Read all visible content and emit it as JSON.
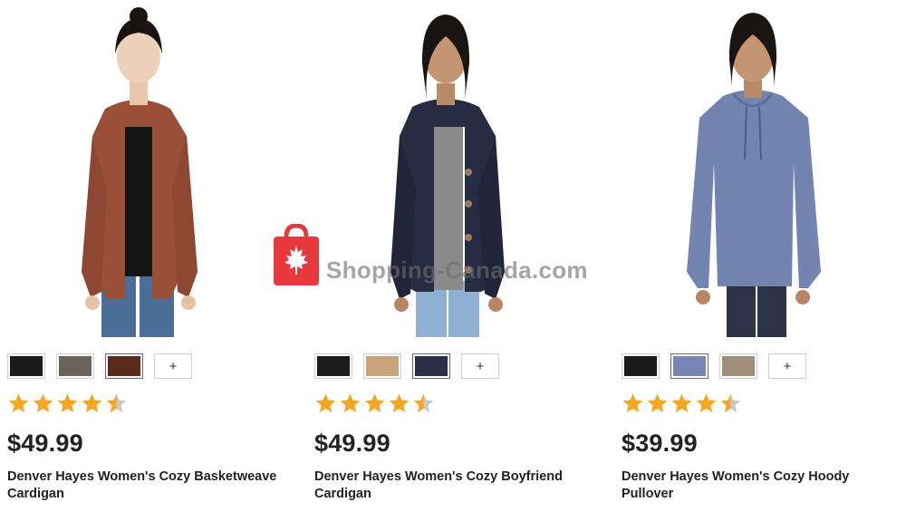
{
  "products": [
    {
      "price": "$49.99",
      "name": "Denver Hayes Women's Cozy Basketweave Cardigan",
      "rating": 4.5,
      "swatches": [
        {
          "color": "#1b1b1b",
          "label": "black"
        },
        {
          "color": "#6b6259",
          "label": "taupe"
        },
        {
          "color": "#5a2a1c",
          "label": "rust"
        }
      ],
      "more_swatches_label": "+",
      "garment_color": "#9a4f38",
      "image_alt": "Woman wearing brown open cardigan"
    },
    {
      "price": "$49.99",
      "name": "Denver Hayes Women's Cozy Boyfriend Cardigan",
      "rating": 4.5,
      "swatches": [
        {
          "color": "#1c1c1c",
          "label": "black"
        },
        {
          "color": "#c9a37a",
          "label": "camel"
        },
        {
          "color": "#2a2f48",
          "label": "navy"
        }
      ],
      "more_swatches_label": "+",
      "garment_color": "#262c42",
      "image_alt": "Woman wearing navy boyfriend cardigan"
    },
    {
      "price": "$39.99",
      "name": "Denver Hayes Women's Cozy Hoody Pullover",
      "rating": 4.5,
      "swatches": [
        {
          "color": "#1a1a1a",
          "label": "black"
        },
        {
          "color": "#7586b5",
          "label": "blue"
        },
        {
          "color": "#a08d7c",
          "label": "mocha"
        }
      ],
      "more_swatches_label": "+",
      "garment_color": "#7384b0",
      "image_alt": "Woman wearing blue hoody pullover"
    }
  ],
  "watermark": {
    "text": "Shopping-Canada.com",
    "icon": "maple-leaf-bag-icon",
    "color": "#e8383d"
  },
  "colors": {
    "star": "#f5a623",
    "star_empty": "#c8c8c8",
    "text": "#222222"
  }
}
